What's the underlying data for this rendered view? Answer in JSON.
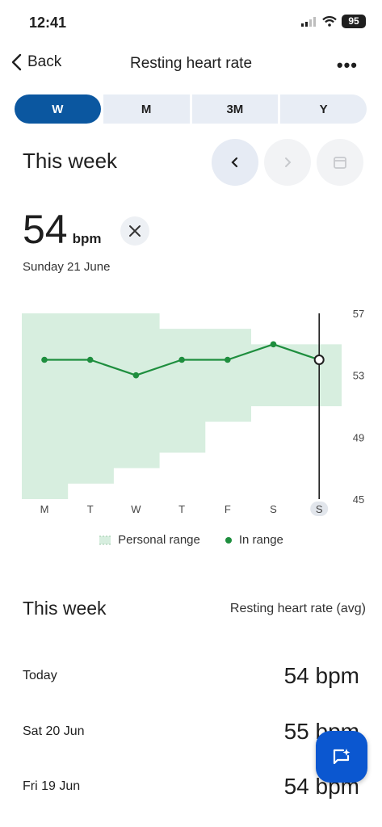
{
  "status": {
    "time": "12:41",
    "battery": "95"
  },
  "header": {
    "back_label": "Back",
    "title": "Resting heart rate",
    "more": "•••"
  },
  "tabs": [
    {
      "label": "W",
      "active": true
    },
    {
      "label": "M",
      "active": false
    },
    {
      "label": "3M",
      "active": false
    },
    {
      "label": "Y",
      "active": false
    }
  ],
  "period": {
    "title": "This week"
  },
  "selected": {
    "value": "54",
    "unit": "bpm",
    "date": "Sunday 21 June"
  },
  "chart_data": {
    "type": "line",
    "categories": [
      "M",
      "T",
      "W",
      "T",
      "F",
      "S",
      "S"
    ],
    "series": [
      {
        "name": "In range",
        "values": [
          54,
          54,
          53,
          54,
          54,
          55,
          54
        ]
      }
    ],
    "personal_range": {
      "name": "Personal range",
      "low": [
        45,
        46,
        47,
        48,
        50,
        51,
        51
      ],
      "high": [
        57,
        57,
        57,
        56,
        56,
        55,
        55
      ]
    },
    "y_ticks": [
      "57",
      "53",
      "49",
      "45"
    ],
    "ylim": [
      45,
      57
    ],
    "selected_index": 6,
    "colors": {
      "line": "#1e8e3e",
      "range": "#d7eedf",
      "selected": "#1f1f1f",
      "selected_day_bg": "#e2e6ec"
    }
  },
  "legend": {
    "range_label": "Personal range",
    "in_range_label": "In range"
  },
  "summary": {
    "title": "This week",
    "subtitle": "Resting heart rate (avg)",
    "rows": [
      {
        "label": "Today",
        "value": "54 bpm"
      },
      {
        "label": "Sat 20 Jun",
        "value": "55 bpm"
      },
      {
        "label": "Fri 19 Jun",
        "value": "54 bpm"
      }
    ]
  }
}
